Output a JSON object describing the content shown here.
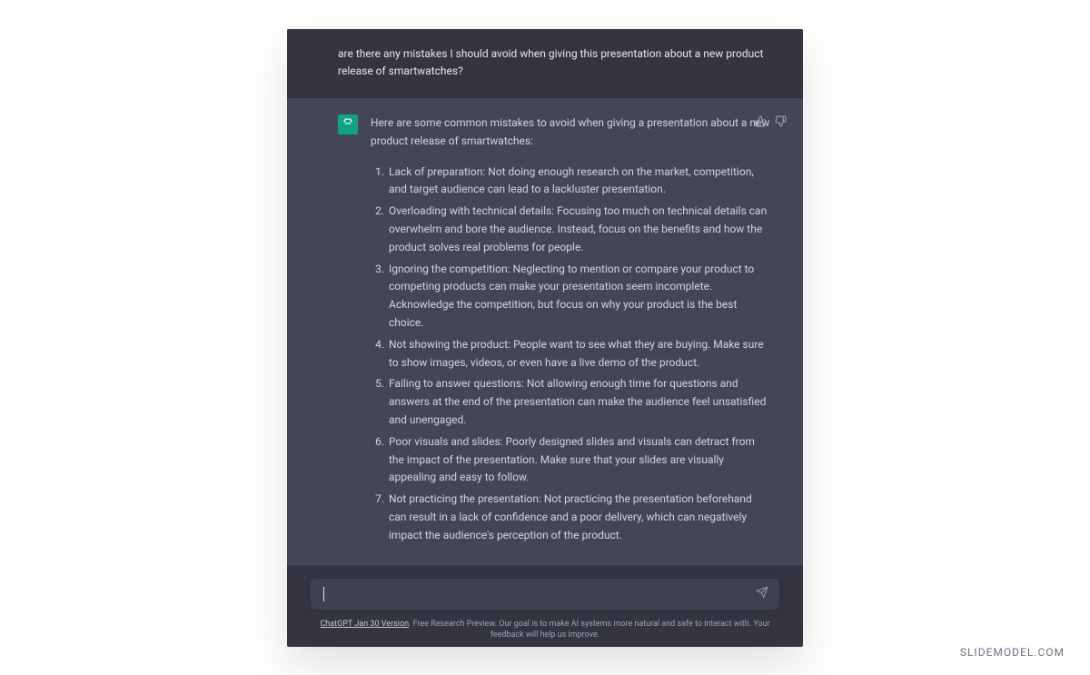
{
  "user_message": "are there any mistakes I should avoid when giving this presentation about a new product release of smartwatches?",
  "assistant": {
    "intro": "Here are some common mistakes to avoid when giving a presentation about a new product release of smartwatches:",
    "items": [
      "Lack of preparation: Not doing enough research on the market, competition, and target audience can lead to a lackluster presentation.",
      "Overloading with technical details: Focusing too much on technical details can overwhelm and bore the audience. Instead, focus on the benefits and how the product solves real problems for people.",
      "Ignoring the competition: Neglecting to mention or compare your product to competing products can make your presentation seem incomplete. Acknowledge the competition, but focus on why your product is the best choice.",
      "Not showing the product: People want to see what they are buying. Make sure to show images, videos, or even have a live demo of the product.",
      "Failing to answer questions: Not allowing enough time for questions and answers at the end of the presentation can make the audience feel unsatisfied and unengaged.",
      "Poor visuals and slides: Poorly designed slides and visuals can detract from the impact of the presentation. Make sure that your slides are visually appealing and easy to follow.",
      "Not practicing the presentation: Not practicing the presentation beforehand can result in a lack of confidence and a poor delivery, which can negatively impact the audience's perception of the product."
    ]
  },
  "input": {
    "placeholder": ""
  },
  "footer": {
    "version_link": "ChatGPT Jan 30 Version",
    "disclaimer": ". Free Research Preview. Our goal is to make AI systems more natural and safe to interact with. Your feedback will help us improve."
  },
  "watermark": "SLIDEMODEL.COM"
}
